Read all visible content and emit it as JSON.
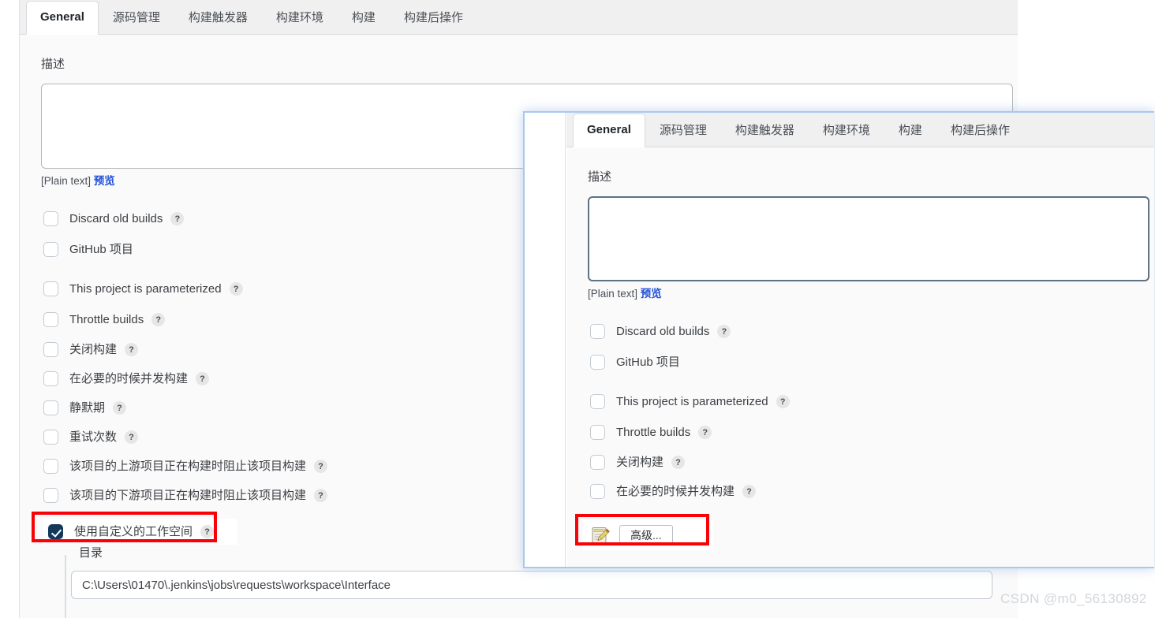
{
  "colors": {
    "accent_red": "#fb0007",
    "checkbox_checked": "#14385c",
    "link_blue": "#1f4fd8",
    "panel_bg": "#fafafa",
    "tabbar_bg": "#f0f0f0",
    "overlay_border": "#a8c8ee"
  },
  "main_panel": {
    "tabs": [
      {
        "label": "General",
        "active": true
      },
      {
        "label": "源码管理",
        "active": false
      },
      {
        "label": "构建触发器",
        "active": false
      },
      {
        "label": "构建环境",
        "active": false
      },
      {
        "label": "构建",
        "active": false
      },
      {
        "label": "构建后操作",
        "active": false
      }
    ],
    "description": {
      "label": "描述",
      "value": "",
      "placeholder": "",
      "format_note": "[Plain text]",
      "preview_link": "预览"
    },
    "checkboxes": [
      {
        "label": "Discard old builds",
        "checked": false,
        "help": "?"
      },
      {
        "label": "GitHub 项目",
        "checked": false,
        "help": ""
      },
      {
        "label": "This project is parameterized",
        "checked": false,
        "help": "?"
      },
      {
        "label": "Throttle builds",
        "checked": false,
        "help": "?"
      },
      {
        "label": "关闭构建",
        "checked": false,
        "help": "?"
      },
      {
        "label": "在必要的时候并发构建",
        "checked": false,
        "help": "?"
      },
      {
        "label": "静默期",
        "checked": false,
        "help": "?"
      },
      {
        "label": "重试次数",
        "checked": false,
        "help": "?"
      },
      {
        "label": "该项目的上游项目正在构建时阻止该项目构建",
        "checked": false,
        "help": "?"
      },
      {
        "label": "该项目的下游项目正在构建时阻止该项目构建",
        "checked": false,
        "help": "?"
      },
      {
        "label": "使用自定义的工作空间",
        "checked": true,
        "help": "?"
      }
    ],
    "directory": {
      "label": "目录",
      "value": "C:\\Users\\01470\\.jenkins\\jobs\\requests\\workspace\\Interface"
    }
  },
  "overlay_panel": {
    "tabs": [
      {
        "label": "General",
        "active": true
      },
      {
        "label": "源码管理",
        "active": false
      },
      {
        "label": "构建触发器",
        "active": false
      },
      {
        "label": "构建环境",
        "active": false
      },
      {
        "label": "构建",
        "active": false
      },
      {
        "label": "构建后操作",
        "active": false
      }
    ],
    "description": {
      "label": "描述",
      "value": "",
      "placeholder": "",
      "format_note": "[Plain text]",
      "preview_link": "预览"
    },
    "checkboxes": [
      {
        "label": "Discard old builds",
        "checked": false,
        "help": "?"
      },
      {
        "label": "GitHub 项目",
        "checked": false,
        "help": ""
      },
      {
        "label": "This project is parameterized",
        "checked": false,
        "help": "?"
      },
      {
        "label": "Throttle builds",
        "checked": false,
        "help": "?"
      },
      {
        "label": "关闭构建",
        "checked": false,
        "help": "?"
      },
      {
        "label": "在必要的时候并发构建",
        "checked": false,
        "help": "?"
      }
    ],
    "advanced_button": {
      "label": "高级...",
      "icon": "notepad-pencil-icon"
    }
  },
  "watermark": "CSDN @m0_56130892"
}
